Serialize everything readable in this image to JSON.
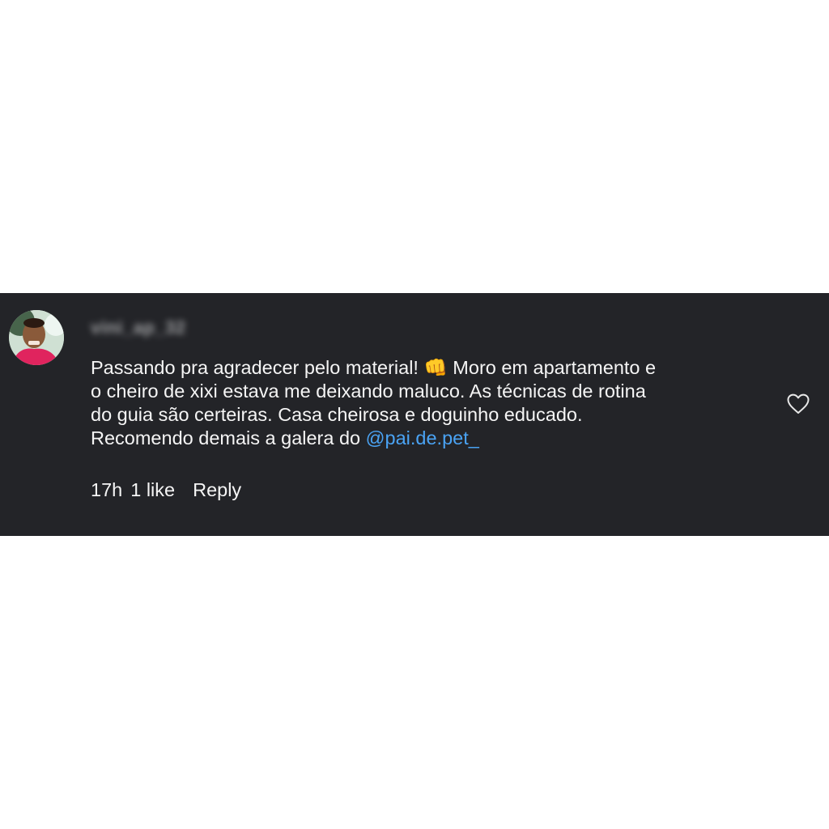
{
  "comment": {
    "username": "vini_ap_32",
    "text_part1": "Passando pra agradecer pelo material! ",
    "emoji": "👊",
    "text_part2": " Moro em apartamento e o cheiro de xixi estava me deixando maluco. As técnicas de rotina do guia são certeiras. Casa cheirosa e doguinho educado. Recomendo demais a galera do ",
    "mention": "@pai.de.pet_",
    "time": "17h",
    "likes": "1 like",
    "reply_label": "Reply",
    "like_icon": "heart-outline-icon"
  },
  "colors": {
    "background": "#232428",
    "text": "#f5f5f5",
    "mention": "#4aa3f4"
  }
}
